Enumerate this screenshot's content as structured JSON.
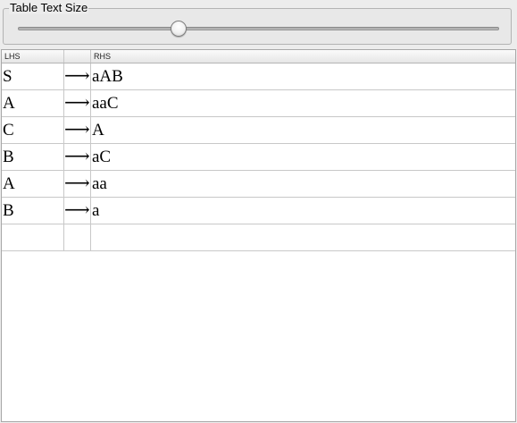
{
  "group": {
    "title": "Table Text Size"
  },
  "slider": {
    "value_fraction": 0.334
  },
  "table": {
    "headers": [
      "LHS",
      "",
      "RHS"
    ],
    "rows": [
      {
        "lhs": "S",
        "arrow": "⟶",
        "rhs": "aAB"
      },
      {
        "lhs": "A",
        "arrow": "⟶",
        "rhs": "aaC"
      },
      {
        "lhs": "C",
        "arrow": "⟶",
        "rhs": "A"
      },
      {
        "lhs": "B",
        "arrow": "⟶",
        "rhs": "aC"
      },
      {
        "lhs": "A",
        "arrow": "⟶",
        "rhs": "aa"
      },
      {
        "lhs": "B",
        "arrow": "⟶",
        "rhs": "a"
      },
      {
        "lhs": "",
        "arrow": "",
        "rhs": ""
      }
    ]
  }
}
